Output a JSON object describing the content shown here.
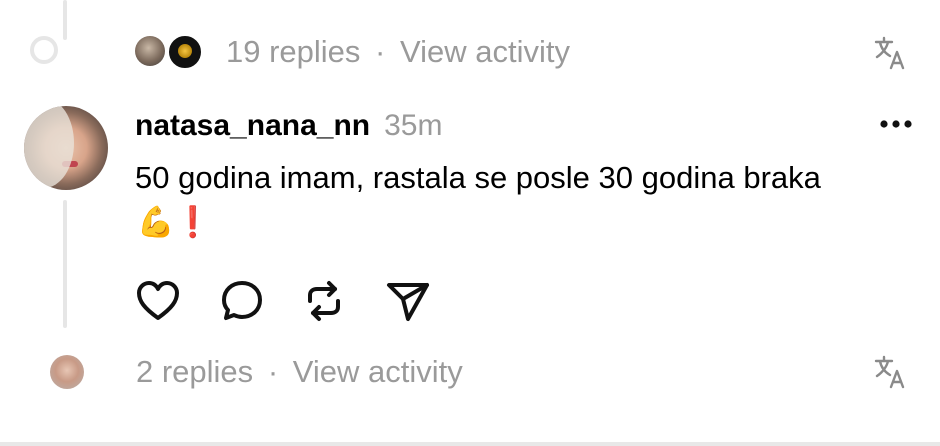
{
  "top_reply_bar": {
    "replies_label": "19 replies",
    "separator": "·",
    "view_activity_label": "View activity",
    "icon": "translate-icon"
  },
  "comment": {
    "username": "natasa_nana_nn",
    "time": "35m",
    "text": "50 godina imam, rastala se posle 30 godina braka",
    "emoji": "💪❗",
    "menu_icon": "more-icon",
    "actions": [
      "heart-icon",
      "comment-icon",
      "repost-icon",
      "share-icon"
    ]
  },
  "bottom_reply_bar": {
    "replies_label": "2 replies",
    "separator": "·",
    "view_activity_label": "View activity",
    "icon": "translate-icon"
  },
  "colors": {
    "muted": "#9a9a9a",
    "thread_line": "#e6e6e6",
    "heart_red": "#e0245e"
  }
}
